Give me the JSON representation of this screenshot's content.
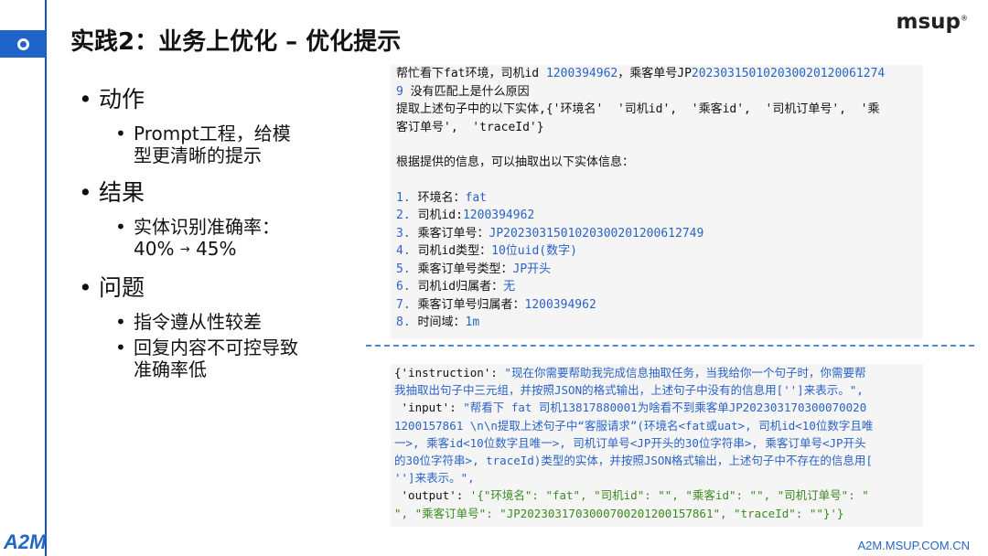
{
  "header": {
    "title": "实践2：业务上优化 – 优化提示",
    "logo": "msup"
  },
  "bullets": {
    "b1_label": "动作",
    "b1_sub1": "Prompt工程，给模",
    "b1_sub1b": "型更清晰的提示",
    "b2_label": "结果",
    "b2_sub1": "实体识别准确率：",
    "b2_sub1_from": "40%",
    "b2_sub1_to": "45%",
    "b3_label": "问题",
    "b3_sub1": "指令遵从性较差",
    "b3_sub2": "回复内容不可控导致",
    "b3_sub2b": "准确率低"
  },
  "panel1": {
    "l1": "帮忙看下fat环境，司机id 1200394962，乘客单号JP202303150102030020120061274",
    "l2": "9 没有匹配上是什么原因",
    "l3": "提取上述句子中的以下实体,{'环境名'  '司机id',  '乘客id',  '司机订单号',  '乘",
    "l4": "客订单号',  'traceId'}",
    "l5": "根据提供的信息，可以抽取出以下实体信息：",
    "items": [
      {
        "n": "1.",
        "k": "环境名：",
        "v": "fat"
      },
      {
        "n": "2.",
        "k": "司机id:",
        "v": "1200394962"
      },
      {
        "n": "3.",
        "k": "乘客订单号：",
        "v": "JP20230315010203002012006 12749"
      },
      {
        "n": "4.",
        "k": "司机id类型：",
        "v": "10位uid(数字)"
      },
      {
        "n": "5.",
        "k": "乘客订单号类型：",
        "v": "JP开头"
      },
      {
        "n": "6.",
        "k": "司机id归属者：",
        "v": "无"
      },
      {
        "n": "7.",
        "k": "乘客订单号归属者：",
        "v": "1200394962"
      },
      {
        "n": "8.",
        "k": "时间域：",
        "v": "1m"
      }
    ]
  },
  "panel2": {
    "l1": "{'instruction': \"现在你需要帮助我完成信息抽取任务，当我给你一个句子时，你需要帮",
    "l2": "我抽取出句子中三元组，并按照JSON的格式输出，上述句子中没有的信息用['']来表示。\",",
    "l3": " 'input': \"帮看下 fat 司机13817880001为啥看不到乘客单JP202303170300070020",
    "l4": "1200157861 \\n\\n提取上述句子中“客服请求”(环境名<fat或uat>, 司机id<10位数字且唯",
    "l5": "一>, 乘客id<10位数字且唯一>, 司机订单号<JP开头的30位字符串>, 乘客订单号<JP开头",
    "l6": "的30位字符串>, traceId)类型的实体，并按照JSON格式输出，上述句子中不存在的信息用[",
    "l7": "'']来表示。\",",
    "l8": " 'output': '{\"环境名\": \"fat\", \"司机id\": \"\", \"乘客id\": \"\", \"司机订单号\": \"",
    "l9": "\", \"乘客订单号\": \"JP20230317030007002012001 57861\", \"traceId\": \"\"}'}"
  },
  "footer": {
    "logo": "A2M",
    "url": "A2M.MSUP.COM.CN"
  },
  "colors": {
    "accent": "#1f63c9",
    "link_blue": "#2a63c7",
    "green": "#3b8a1f"
  }
}
